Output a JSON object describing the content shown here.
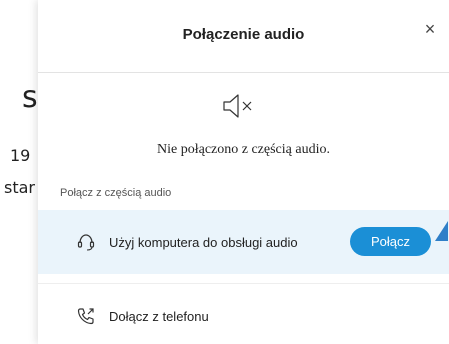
{
  "background": {
    "fragment_1": "s",
    "fragment_2": "19",
    "fragment_3": "star"
  },
  "dialog": {
    "title": "Połączenie audio",
    "close_glyph": "×",
    "status_text": "Nie połączono z częścią audio.",
    "section_label": "Połącz z częścią audio",
    "options": [
      {
        "label": "Użyj komputera do obsługi audio",
        "icon": "headset-icon",
        "button_label": "Połącz"
      },
      {
        "label": "Dołącz z telefonu",
        "icon": "phone-icon"
      }
    ]
  },
  "colors": {
    "accent": "#1b8fd6",
    "highlight_row": "#eaf4fb"
  }
}
